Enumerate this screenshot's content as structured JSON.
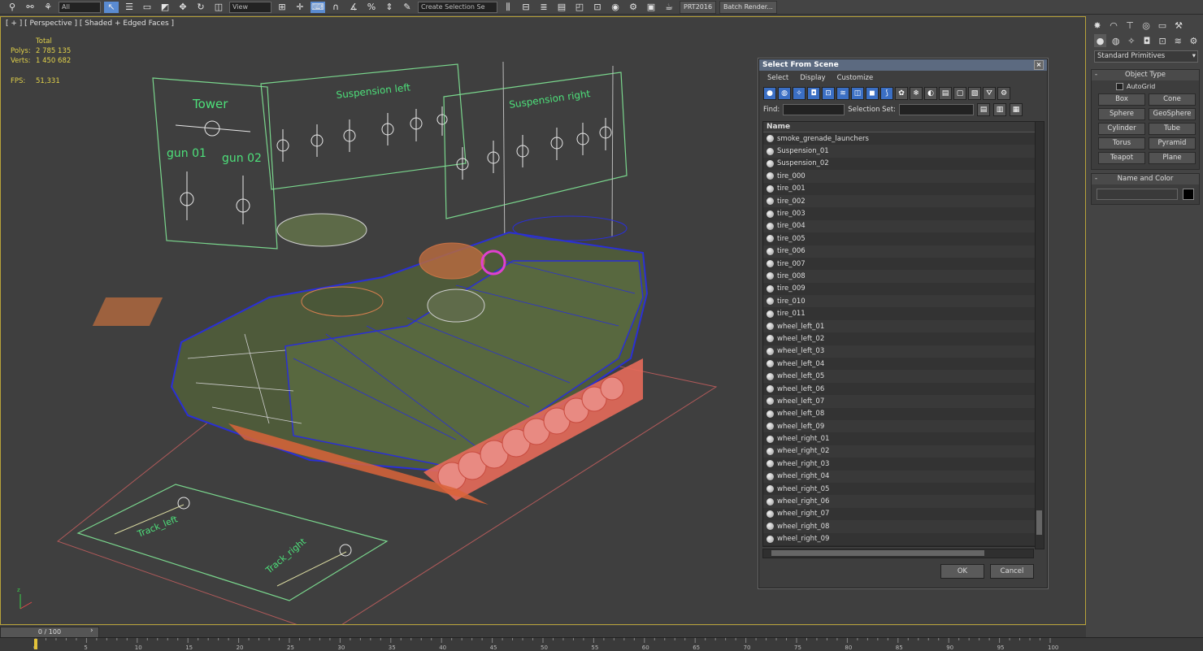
{
  "toolbar": {
    "filter_value": "All",
    "view_value": "View",
    "selection_set_placeholder": "Create Selection Se",
    "prt_label": "PRT2016",
    "batch_render_label": "Batch Render..."
  },
  "viewport": {
    "label": "[ + ] [ Perspective ] [ Shaded + Edged Faces ]",
    "stats": {
      "header": "Total",
      "polys_label": "Polys:",
      "polys_value": "2 785 135",
      "verts_label": "Verts:",
      "verts_value": "1 450 682",
      "fps_label": "FPS:",
      "fps_value": "51,331"
    },
    "scene_labels": {
      "tower": "Tower",
      "gun1": "gun 01",
      "gun2": "gun 02",
      "susp_left": "Suspension left",
      "susp_right": "Suspension right",
      "track_left": "Track_left",
      "track_right": "Track_right"
    }
  },
  "dialog": {
    "title": "Select From Scene",
    "menu": [
      "Select",
      "Display",
      "Customize"
    ],
    "find_label": "Find:",
    "selection_set_label": "Selection Set:",
    "column_name": "Name",
    "items": [
      "smoke_grenade_launchers",
      "Suspension_01",
      "Suspension_02",
      "tire_000",
      "tire_001",
      "tire_002",
      "tire_003",
      "tire_004",
      "tire_005",
      "tire_006",
      "tire_007",
      "tire_008",
      "tire_009",
      "tire_010",
      "tire_011",
      "wheel_left_01",
      "wheel_left_02",
      "wheel_left_03",
      "wheel_left_04",
      "wheel_left_05",
      "wheel_left_06",
      "wheel_left_07",
      "wheel_left_08",
      "wheel_left_09",
      "wheel_right_01",
      "wheel_right_02",
      "wheel_right_03",
      "wheel_right_04",
      "wheel_right_05",
      "wheel_right_06",
      "wheel_right_07",
      "wheel_right_08",
      "wheel_right_09"
    ],
    "ok_label": "OK",
    "cancel_label": "Cancel"
  },
  "command_panel": {
    "dropdown_value": "Standard Primitives",
    "object_type_title": "Object Type",
    "autogrid_label": "AutoGrid",
    "primitives": [
      "Box",
      "Cone",
      "Sphere",
      "GeoSphere",
      "Cylinder",
      "Tube",
      "Torus",
      "Pyramid",
      "Teapot",
      "Plane"
    ],
    "name_color_title": "Name and Color",
    "object_color": "#000000"
  },
  "timeline": {
    "slider_label": "0 / 100",
    "ticks": [
      "0",
      "5",
      "10",
      "15",
      "20",
      "25",
      "30",
      "35",
      "40",
      "45",
      "50",
      "55",
      "60",
      "65",
      "70",
      "75",
      "80",
      "85",
      "90",
      "95",
      "100"
    ]
  }
}
